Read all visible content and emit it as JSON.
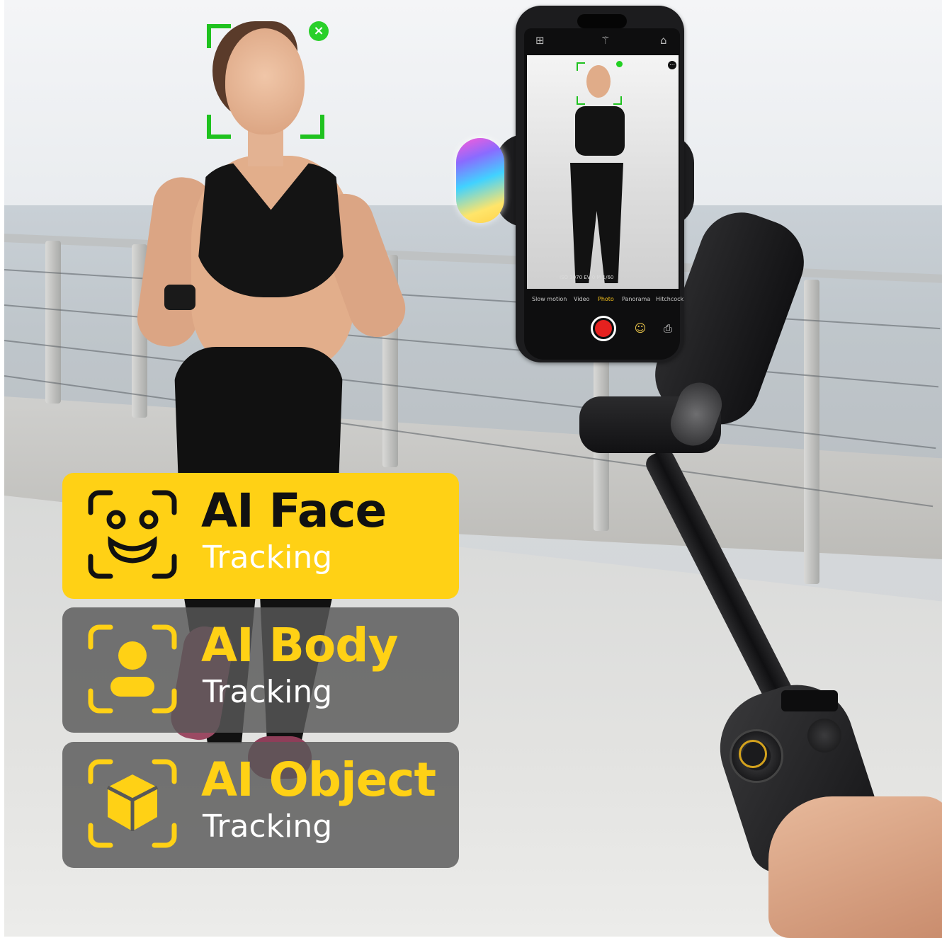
{
  "features": [
    {
      "title": "AI Face",
      "subtitle": "Tracking",
      "icon": "face-scan-icon",
      "highlighted": true
    },
    {
      "title": "AI Body",
      "subtitle": "Tracking",
      "icon": "body-scan-icon",
      "highlighted": false
    },
    {
      "title": "AI Object",
      "subtitle": "Tracking",
      "icon": "object-scan-icon",
      "highlighted": false
    }
  ],
  "phone_app": {
    "camera_params": "ISO 3070  EV 0   M 1/60",
    "modes": [
      "Slow motion",
      "Video",
      "Photo",
      "Panorama",
      "Hitchcock"
    ],
    "active_mode": "Photo",
    "top_icons": [
      "grid-icon",
      "magic-wand-icon",
      "home-icon"
    ]
  },
  "colors": {
    "accent_yellow": "#ffd115",
    "card_gray": "#585858",
    "tracking_green": "#1fc21f",
    "record_red": "#e5211f"
  }
}
